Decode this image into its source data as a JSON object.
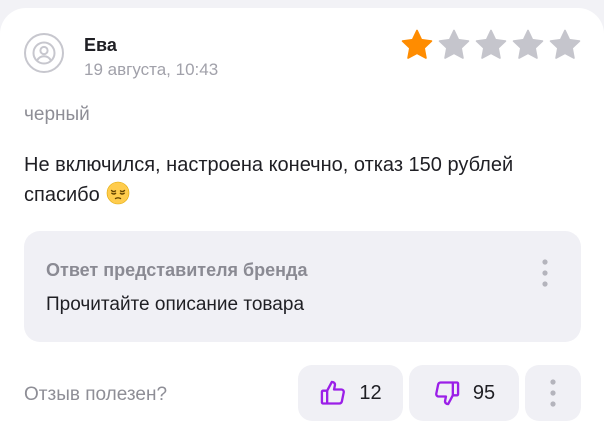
{
  "review": {
    "author": "Ева",
    "date": "19 августа, 10:43",
    "rating": 1,
    "rating_max": 5,
    "variant": "черный",
    "text_line1": "Не включился, настроена конечно, отказ 150 рублей",
    "text_line2": "спасибо",
    "text_emoji": "pensive-face-emoji"
  },
  "brand_reply": {
    "title": "Ответ представителя бренда",
    "text": "Прочитайте описание товара"
  },
  "helpful": {
    "label": "Отзыв полезен?",
    "likes": "12",
    "dislikes": "95"
  },
  "colors": {
    "accent": "#9b1fe8",
    "star_filled": "#ff8c00",
    "star_empty": "#c5c5cc",
    "panel_bg": "#f0f0f5"
  },
  "icons": {
    "avatar": "user-avatar-icon",
    "like": "thumbs-up-icon",
    "dislike": "thumbs-down-icon",
    "more": "vertical-dots-icon"
  }
}
